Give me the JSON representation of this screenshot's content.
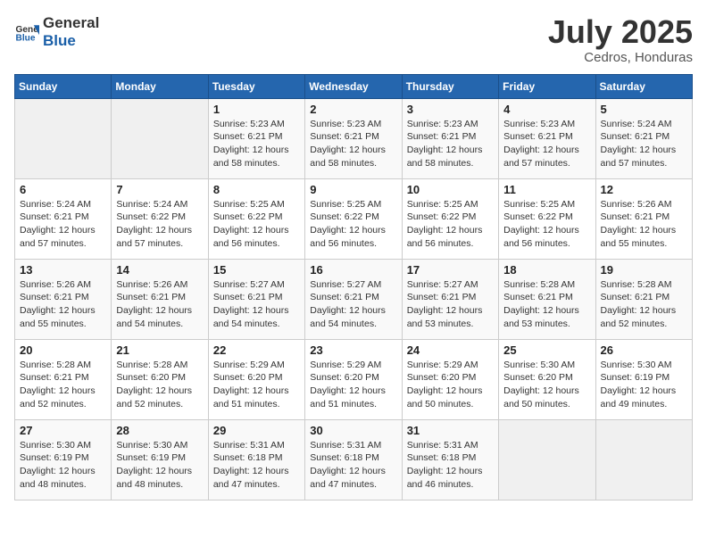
{
  "header": {
    "logo_general": "General",
    "logo_blue": "Blue",
    "month_year": "July 2025",
    "location": "Cedros, Honduras"
  },
  "days_of_week": [
    "Sunday",
    "Monday",
    "Tuesday",
    "Wednesday",
    "Thursday",
    "Friday",
    "Saturday"
  ],
  "weeks": [
    [
      {
        "day": "",
        "info": ""
      },
      {
        "day": "",
        "info": ""
      },
      {
        "day": "1",
        "sunrise": "5:23 AM",
        "sunset": "6:21 PM",
        "daylight": "12 hours and 58 minutes."
      },
      {
        "day": "2",
        "sunrise": "5:23 AM",
        "sunset": "6:21 PM",
        "daylight": "12 hours and 58 minutes."
      },
      {
        "day": "3",
        "sunrise": "5:23 AM",
        "sunset": "6:21 PM",
        "daylight": "12 hours and 58 minutes."
      },
      {
        "day": "4",
        "sunrise": "5:23 AM",
        "sunset": "6:21 PM",
        "daylight": "12 hours and 57 minutes."
      },
      {
        "day": "5",
        "sunrise": "5:24 AM",
        "sunset": "6:21 PM",
        "daylight": "12 hours and 57 minutes."
      }
    ],
    [
      {
        "day": "6",
        "sunrise": "5:24 AM",
        "sunset": "6:21 PM",
        "daylight": "12 hours and 57 minutes."
      },
      {
        "day": "7",
        "sunrise": "5:24 AM",
        "sunset": "6:22 PM",
        "daylight": "12 hours and 57 minutes."
      },
      {
        "day": "8",
        "sunrise": "5:25 AM",
        "sunset": "6:22 PM",
        "daylight": "12 hours and 56 minutes."
      },
      {
        "day": "9",
        "sunrise": "5:25 AM",
        "sunset": "6:22 PM",
        "daylight": "12 hours and 56 minutes."
      },
      {
        "day": "10",
        "sunrise": "5:25 AM",
        "sunset": "6:22 PM",
        "daylight": "12 hours and 56 minutes."
      },
      {
        "day": "11",
        "sunrise": "5:25 AM",
        "sunset": "6:22 PM",
        "daylight": "12 hours and 56 minutes."
      },
      {
        "day": "12",
        "sunrise": "5:26 AM",
        "sunset": "6:21 PM",
        "daylight": "12 hours and 55 minutes."
      }
    ],
    [
      {
        "day": "13",
        "sunrise": "5:26 AM",
        "sunset": "6:21 PM",
        "daylight": "12 hours and 55 minutes."
      },
      {
        "day": "14",
        "sunrise": "5:26 AM",
        "sunset": "6:21 PM",
        "daylight": "12 hours and 54 minutes."
      },
      {
        "day": "15",
        "sunrise": "5:27 AM",
        "sunset": "6:21 PM",
        "daylight": "12 hours and 54 minutes."
      },
      {
        "day": "16",
        "sunrise": "5:27 AM",
        "sunset": "6:21 PM",
        "daylight": "12 hours and 54 minutes."
      },
      {
        "day": "17",
        "sunrise": "5:27 AM",
        "sunset": "6:21 PM",
        "daylight": "12 hours and 53 minutes."
      },
      {
        "day": "18",
        "sunrise": "5:28 AM",
        "sunset": "6:21 PM",
        "daylight": "12 hours and 53 minutes."
      },
      {
        "day": "19",
        "sunrise": "5:28 AM",
        "sunset": "6:21 PM",
        "daylight": "12 hours and 52 minutes."
      }
    ],
    [
      {
        "day": "20",
        "sunrise": "5:28 AM",
        "sunset": "6:21 PM",
        "daylight": "12 hours and 52 minutes."
      },
      {
        "day": "21",
        "sunrise": "5:28 AM",
        "sunset": "6:20 PM",
        "daylight": "12 hours and 52 minutes."
      },
      {
        "day": "22",
        "sunrise": "5:29 AM",
        "sunset": "6:20 PM",
        "daylight": "12 hours and 51 minutes."
      },
      {
        "day": "23",
        "sunrise": "5:29 AM",
        "sunset": "6:20 PM",
        "daylight": "12 hours and 51 minutes."
      },
      {
        "day": "24",
        "sunrise": "5:29 AM",
        "sunset": "6:20 PM",
        "daylight": "12 hours and 50 minutes."
      },
      {
        "day": "25",
        "sunrise": "5:30 AM",
        "sunset": "6:20 PM",
        "daylight": "12 hours and 50 minutes."
      },
      {
        "day": "26",
        "sunrise": "5:30 AM",
        "sunset": "6:19 PM",
        "daylight": "12 hours and 49 minutes."
      }
    ],
    [
      {
        "day": "27",
        "sunrise": "5:30 AM",
        "sunset": "6:19 PM",
        "daylight": "12 hours and 48 minutes."
      },
      {
        "day": "28",
        "sunrise": "5:30 AM",
        "sunset": "6:19 PM",
        "daylight": "12 hours and 48 minutes."
      },
      {
        "day": "29",
        "sunrise": "5:31 AM",
        "sunset": "6:18 PM",
        "daylight": "12 hours and 47 minutes."
      },
      {
        "day": "30",
        "sunrise": "5:31 AM",
        "sunset": "6:18 PM",
        "daylight": "12 hours and 47 minutes."
      },
      {
        "day": "31",
        "sunrise": "5:31 AM",
        "sunset": "6:18 PM",
        "daylight": "12 hours and 46 minutes."
      },
      {
        "day": "",
        "info": ""
      },
      {
        "day": "",
        "info": ""
      }
    ]
  ]
}
